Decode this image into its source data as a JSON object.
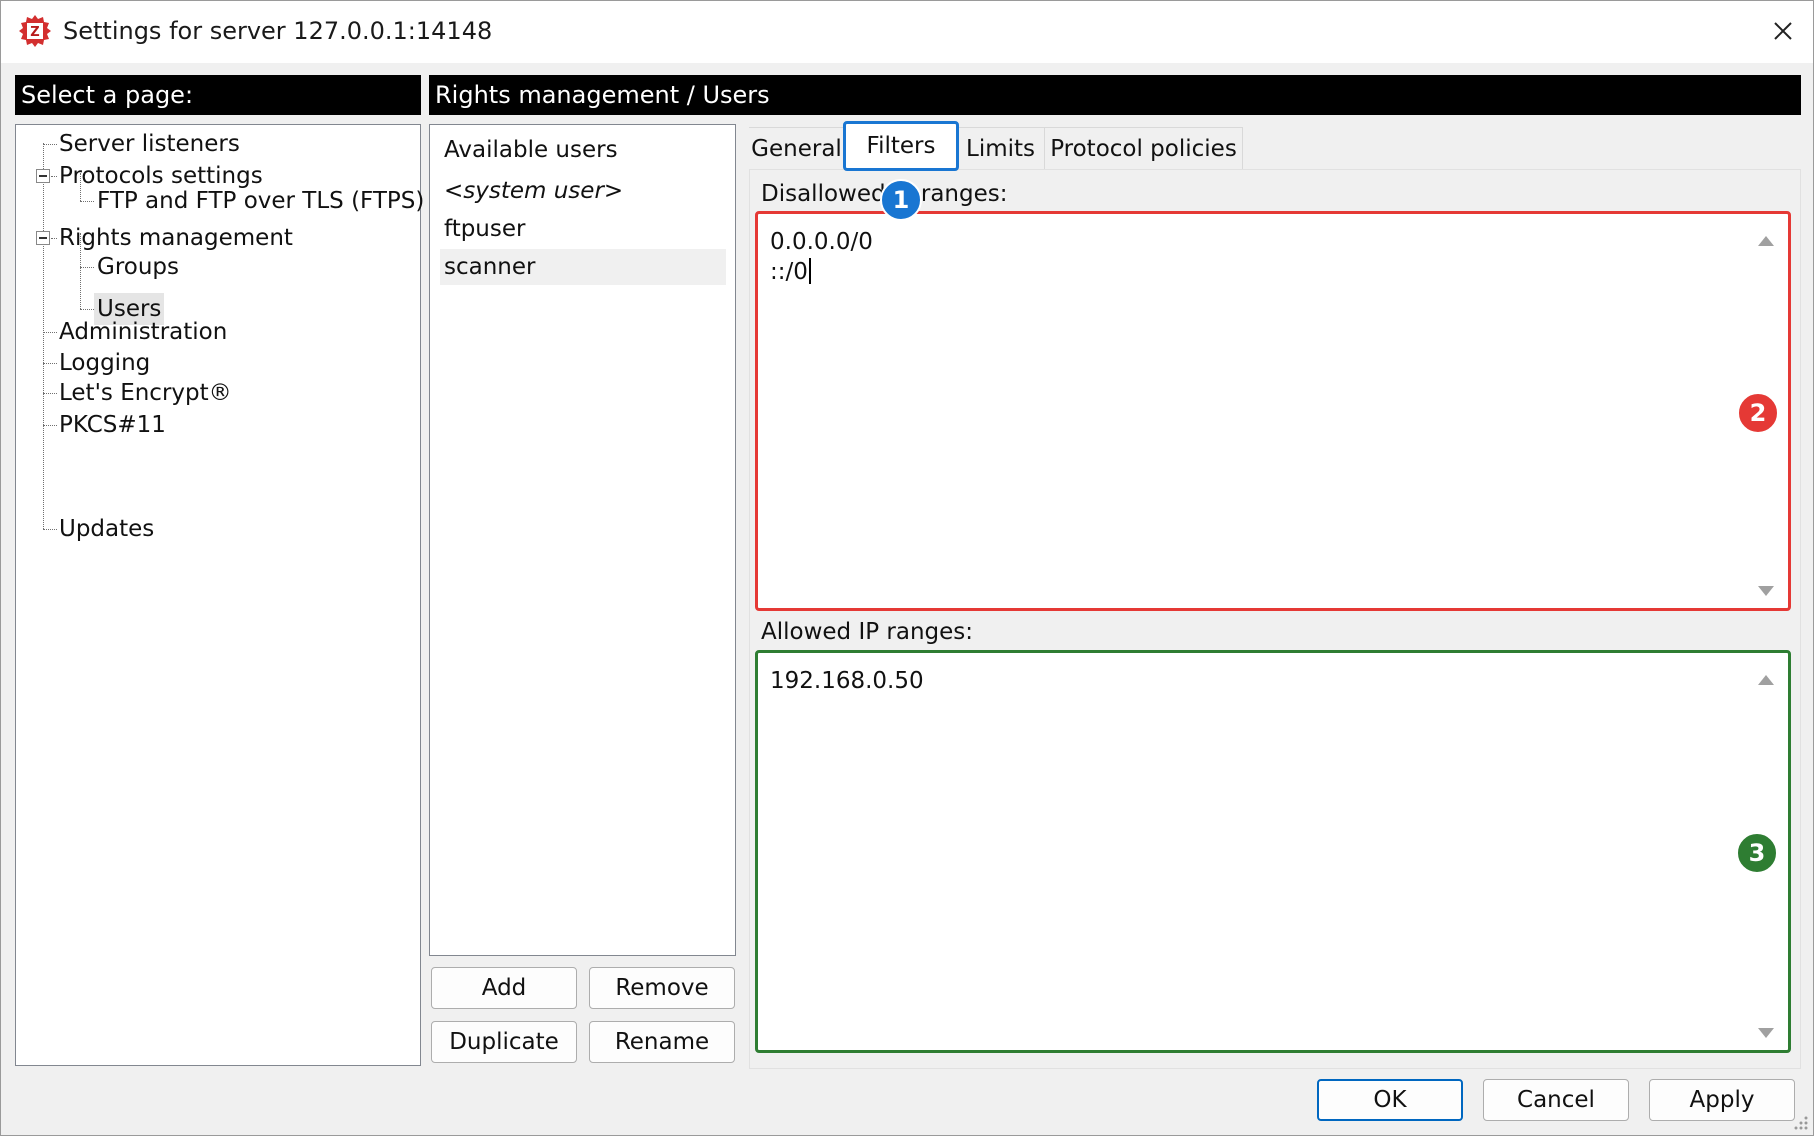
{
  "window": {
    "title": "Settings for server 127.0.0.1:14148",
    "colors": {
      "title_bg": "#ffffff",
      "header_bg": "#000000",
      "accent_blue": "#1976d2",
      "annotation_red": "#e53935",
      "annotation_green": "#2e7d32"
    }
  },
  "left_header": "Select a page:",
  "right_header": "Rights management / Users",
  "tree": {
    "server_listeners": "Server listeners",
    "protocols_settings": "Protocols settings",
    "ftp_ftps": "FTP and FTP over TLS (FTPS)",
    "rights_management": "Rights management",
    "groups": "Groups",
    "users": "Users",
    "administration": "Administration",
    "logging": "Logging",
    "lets_encrypt": "Let's Encrypt®",
    "pkcs11": "PKCS#11",
    "updates": "Updates"
  },
  "users": {
    "header": "Available users",
    "items": [
      "<system user>",
      "ftpuser",
      "scanner"
    ],
    "selected": "scanner"
  },
  "user_buttons": {
    "add": "Add",
    "remove": "Remove",
    "duplicate": "Duplicate",
    "rename": "Rename"
  },
  "tabs": {
    "general": "General",
    "filters": "Filters",
    "limits": "Limits",
    "protocol_policies": "Protocol policies",
    "active": "Filters"
  },
  "filters": {
    "disallowed_label": "Disallowed IP ranges:",
    "disallowed_lines": [
      "0.0.0.0/0",
      "::/0"
    ],
    "allowed_label": "Allowed IP ranges:",
    "allowed_lines": [
      "192.168.0.50"
    ]
  },
  "badges": {
    "one": "1",
    "two": "2",
    "three": "3"
  },
  "dialog_buttons": {
    "ok": "OK",
    "cancel": "Cancel",
    "apply": "Apply"
  },
  "icons": {
    "app": "filezilla-server-icon",
    "close": "close-icon",
    "grip": "resize-grip-icon"
  }
}
